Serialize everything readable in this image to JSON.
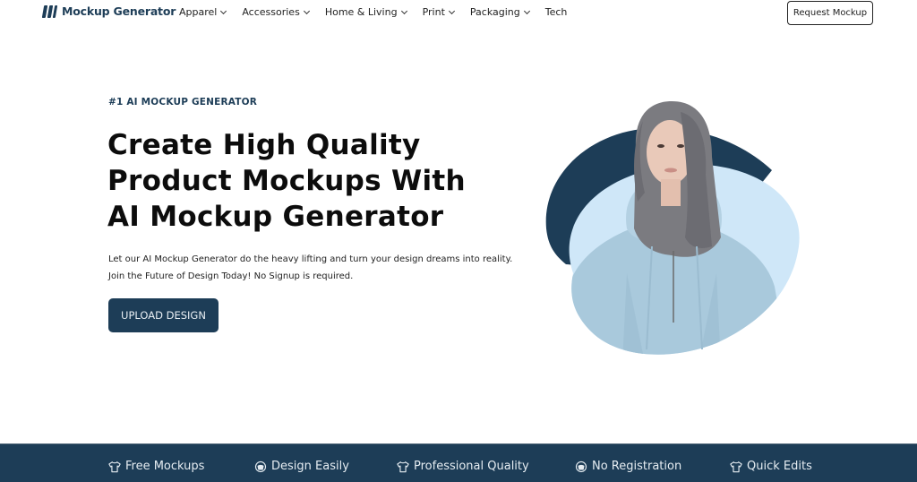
{
  "brand": {
    "name": "Mockup Generator",
    "primary_color": "#1d3d57",
    "light_blob_color": "#cfe7f8"
  },
  "nav": {
    "items": [
      {
        "label": "Apparel",
        "has_dropdown": true
      },
      {
        "label": "Accessories",
        "has_dropdown": true
      },
      {
        "label": "Home & Living",
        "has_dropdown": true
      },
      {
        "label": "Print",
        "has_dropdown": true
      },
      {
        "label": "Packaging",
        "has_dropdown": true
      },
      {
        "label": "Tech",
        "has_dropdown": false
      }
    ],
    "cta_label": "Request Mockup"
  },
  "hero": {
    "eyebrow": "#1 AI MOCKUP GENERATOR",
    "headline_lines": [
      "Create High Quality",
      "Product Mockups With",
      "AI Mockup Generator"
    ],
    "description_lines": [
      "Let our AI Mockup Generator do the heavy lifting and turn your design dreams into reality.",
      "Join the Future of Design Today! No Signup is required."
    ],
    "upload_label": "UPLOAD DESIGN",
    "image_alt": "Woman wearing light blue hoodie"
  },
  "features": [
    {
      "icon": "tshirt-icon",
      "label": "Free Mockups"
    },
    {
      "icon": "hoodie-icon",
      "label": "Design Easily"
    },
    {
      "icon": "tshirt-icon",
      "label": "Professional Quality"
    },
    {
      "icon": "hoodie-icon",
      "label": "No Registration"
    },
    {
      "icon": "tshirt-icon",
      "label": "Quick Edits"
    }
  ]
}
